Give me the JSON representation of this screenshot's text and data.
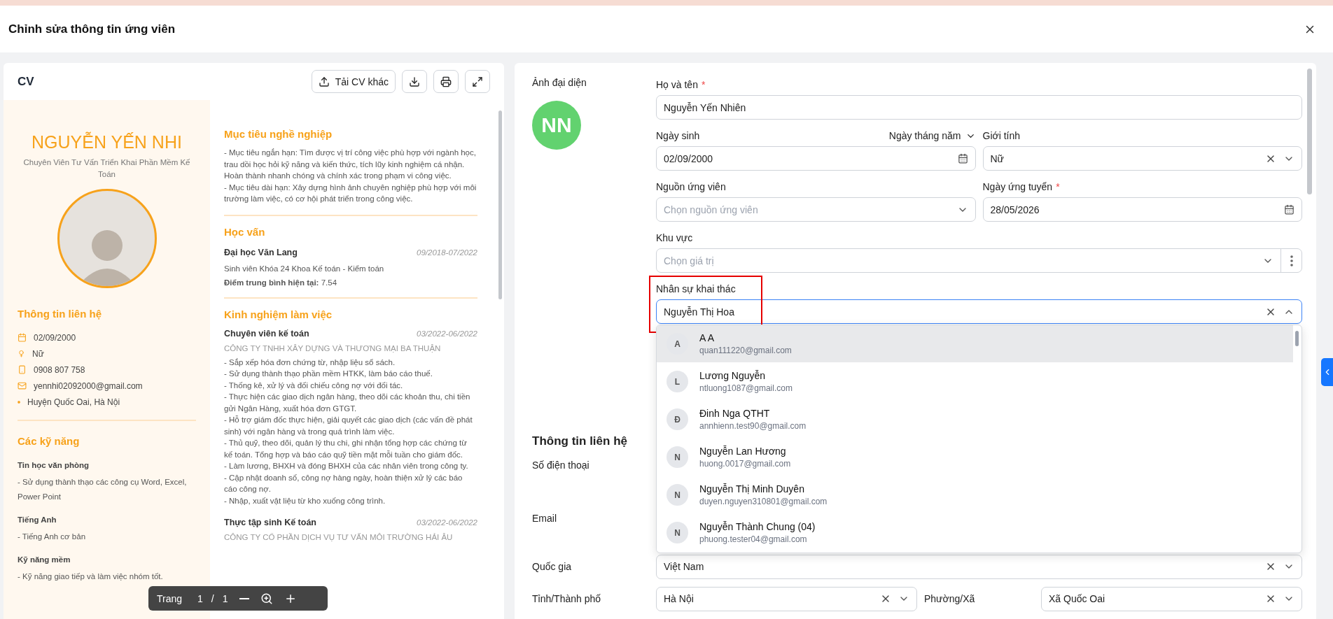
{
  "dialog": {
    "title": "Chỉnh sửa thông tin ứng viên"
  },
  "cv_panel": {
    "title": "CV",
    "upload_button": "Tải CV khác",
    "document": {
      "name": "NGUYỄN YẾN NHI",
      "position": "Chuyên Viên Tư Vấn Triển Khai Phần Mềm Kế Toán",
      "contact_title": "Thông tin liên hệ",
      "contact": [
        {
          "kind": "date",
          "text": "02/09/2000"
        },
        {
          "kind": "gender",
          "text": "Nữ"
        },
        {
          "kind": "phone",
          "text": "0908 807 758"
        },
        {
          "kind": "email",
          "text": "yennhi02092000@gmail.com"
        },
        {
          "kind": "address",
          "text": "Huyện Quốc Oai, Hà Nội"
        }
      ],
      "skills_title": "Các kỹ năng",
      "skills": [
        {
          "title": "Tin học văn phòng",
          "text": "- Sử dụng thành thạo các công cụ Word, Excel, Power Point"
        },
        {
          "title": "Tiếng Anh",
          "text": "- Tiếng Anh cơ bản"
        },
        {
          "title": "Kỹ năng mềm",
          "text": "- Kỹ năng giao tiếp và làm việc nhóm tốt."
        }
      ],
      "objective": {
        "title": "Mục tiêu nghề nghiệp",
        "lines": [
          "- Mục tiêu ngắn hạn: Tìm được vị trí công việc phù hợp với ngành học, trau dồi học hỏi kỹ năng và kiến thức, tích lũy kinh nghiệm cá nhận. Hoàn thành nhanh chóng và chính xác trong phạm vi công việc.",
          "- Mục tiêu dài hạn: Xây dựng hình ảnh chuyên nghiệp phù hợp với môi trường làm việc, có cơ hội phát triển trong công việc."
        ]
      },
      "education": {
        "title": "Học vấn",
        "school": "Đại học Văn Lang",
        "period": "09/2018-07/2022",
        "major": "Sinh viên Khóa 24 Khoa Kế toán - Kiểm toán",
        "gpa": "**Điểm trung bình hiện tại:** 7.54"
      },
      "experience": {
        "title": "Kinh nghiệm làm việc",
        "jobs": [
          {
            "title": "Chuyên viên kế toán",
            "period": "03/2022-06/2022",
            "company": "CÔNG TY TNHH XÂY DỰNG VÀ THƯƠNG MẠI BA THUẬN",
            "bullets": [
              "- Sắp xếp hóa đơn chứng từ, nhập liệu sổ sách.",
              "- Sử dụng thành thạo phần mềm HTKK, làm báo cáo thuế.",
              "- Thống kê, xử lý và đối chiếu công nợ với đối tác.",
              "- Thực hiện các giao dịch ngân hàng, theo dõi các khoản thu, chi tiền gửi Ngân Hàng, xuất hóa đơn GTGT.",
              "- Hỗ trợ giám đốc thực hiện, giải quyết các giao dịch (các vấn đề phát sinh) với ngân hàng và trong quá trình làm việc.",
              "- Thủ quỹ, theo dõi, quản lý thu chi, ghi nhận tổng hợp các chứng từ kế toán. Tổng hợp và báo cáo quỹ tiền mặt mỗi tuần cho giám đốc.",
              "- Làm lương, BHXH và đóng BHXH của các nhân viên trong công ty.",
              "- Cập nhật doanh số, công nợ hàng ngày, hoàn thiện xử lý các báo cáo công nợ.",
              "- Nhập, xuất vật liệu từ kho xuống công trình."
            ]
          },
          {
            "title": "Thực tập sinh Kế toán",
            "period": "03/2022-06/2022",
            "company": "CÔNG TY CỔ PHẦN DỊCH VỤ TƯ VẤN MÔI TRƯỜNG HẢI ÂU"
          }
        ]
      }
    },
    "pager": {
      "label": "Trang",
      "page": "1",
      "separator": "/",
      "total": "1"
    }
  },
  "form": {
    "avatar_label": "Ảnh đại diện",
    "avatar_initials": "NN",
    "full_name": {
      "label": "Họ và tên",
      "required_mark": "*",
      "value": "Nguyễn Yến Nhiên"
    },
    "birth_date": {
      "label": "Ngày sinh",
      "format": "Ngày tháng năm",
      "value": "02/09/2000"
    },
    "gender": {
      "label": "Giới tính",
      "value": "Nữ"
    },
    "source": {
      "label": "Nguồn ứng viên",
      "placeholder": "Chọn nguồn ứng viên"
    },
    "apply_date": {
      "label": "Ngày ứng tuyển",
      "required_mark": "*",
      "value": "28/05/2026"
    },
    "region": {
      "label": "Khu vực",
      "placeholder": "Chọn giá trị"
    },
    "recruiter": {
      "label": "Nhân sự khai thác",
      "value": "Nguyễn Thị Hoa",
      "expanded": true,
      "options": [
        {
          "initial": "A",
          "name": "A A",
          "email": "quan111220@gmail.com",
          "selected": true
        },
        {
          "initial": "L",
          "name": "Lương Nguyễn",
          "email": "ntluong1087@gmail.com",
          "selected": false
        },
        {
          "initial": "Đ",
          "name": "Đinh Nga QTHT",
          "email": "annhienn.test90@gmail.com",
          "selected": false
        },
        {
          "initial": "N",
          "name": "Nguyễn Lan Hương",
          "email": "huong.0017@gmail.com",
          "selected": false
        },
        {
          "initial": "N",
          "name": "Nguyễn Thị Minh Duyên",
          "email": "duyen.nguyen310801@gmail.com",
          "selected": false
        },
        {
          "initial": "N",
          "name": "Nguyễn Thành Chung (04)",
          "email": "phuong.tester04@gmail.com",
          "selected": false
        }
      ]
    },
    "contact_title": "Thông tin liên hệ",
    "phone": {
      "label": "Số điện thoại"
    },
    "email": {
      "label": "Email"
    },
    "country": {
      "label": "Quốc gia",
      "value": "Việt Nam"
    },
    "province": {
      "label": "Tỉnh/Thành phố",
      "value": "Hà Nội"
    },
    "ward": {
      "label": "Phường/Xã",
      "value": "Xã Quốc Oai"
    }
  }
}
